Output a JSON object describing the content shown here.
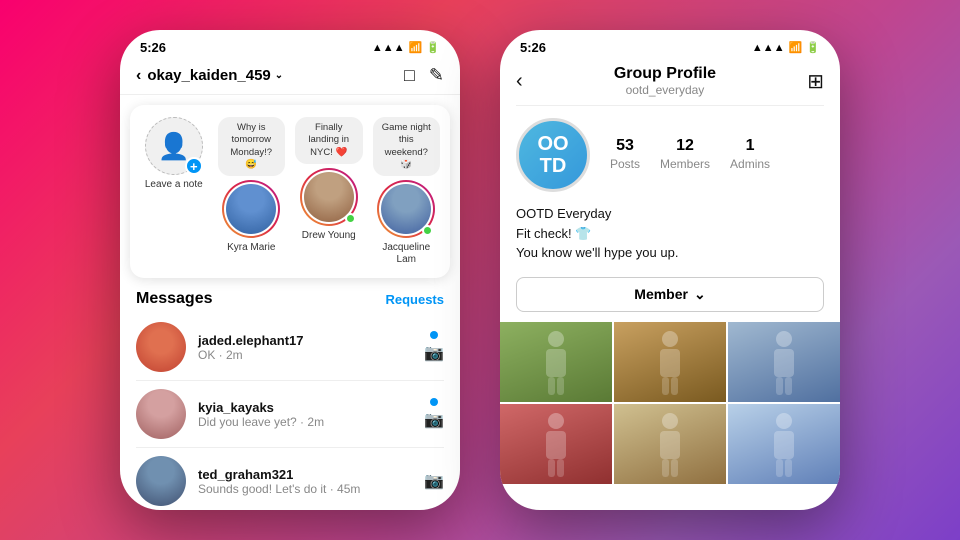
{
  "background": {
    "gradient": "135deg, #f9006e 0%, #e8405a 30%, #c0458f 60%, #9b59b6 80%, #7d3fc8 100%"
  },
  "left_phone": {
    "status_time": "5:26",
    "nav_username": "okay_kaiden_459",
    "nav_chevron": "∨",
    "stories": [
      {
        "id": "leave_note",
        "name": "Leave a note",
        "has_plus": true,
        "type": "note"
      },
      {
        "id": "kyra_marie",
        "name": "Kyra Marie",
        "bubble": "Why is tomorrow Monday!? 😅",
        "has_dot": false,
        "type": "story"
      },
      {
        "id": "drew_young",
        "name": "Drew Young",
        "bubble": "Finally landing in NYC! ❤️",
        "has_dot": true,
        "type": "story"
      },
      {
        "id": "jacqueline_lam",
        "name": "Jacqueline Lam",
        "bubble": "Game night this weekend? 🎲",
        "has_dot": true,
        "type": "story"
      }
    ],
    "messages_title": "Messages",
    "requests_label": "Requests",
    "messages": [
      {
        "username": "jaded.elephant17",
        "preview": "OK · 2m",
        "has_dot": true
      },
      {
        "username": "kyia_kayaks",
        "preview": "Did you leave yet? · 2m",
        "has_dot": true
      },
      {
        "username": "ted_graham321",
        "preview": "Sounds good! Let's do it · 45m",
        "has_dot": false
      }
    ]
  },
  "right_phone": {
    "status_time": "5:26",
    "group_title": "Group Profile",
    "group_handle": "ootd_everyday",
    "group_logo_text": "OO\nTD",
    "stats": [
      {
        "num": "53",
        "label": "Posts"
      },
      {
        "num": "12",
        "label": "Members"
      },
      {
        "num": "1",
        "label": "Admins"
      }
    ],
    "bio_lines": [
      "OOTD Everyday",
      "Fit check! 👕",
      "You know we'll hype you up."
    ],
    "member_button": "Member",
    "grid_cells": [
      "outdoor_fashion_1",
      "street_style_2",
      "casual_style_3",
      "colorful_outfit_4",
      "neutral_style_5",
      "athletic_style_6"
    ]
  }
}
